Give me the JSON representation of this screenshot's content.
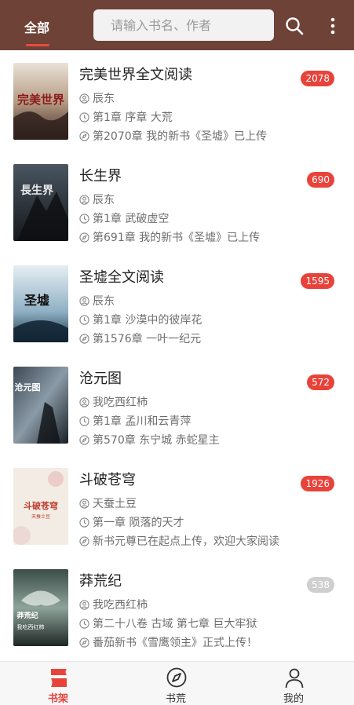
{
  "header": {
    "tab_label": "全部",
    "search_placeholder": "请输入书名、作者"
  },
  "books": [
    {
      "title": "完美世界全文阅读",
      "author": "辰东",
      "first_chapter": "第1章 序章 大荒",
      "latest_chapter": "第2070章 我的新书《圣墟》已上传",
      "badge": "2078",
      "badge_color": "#e8433b",
      "cover_text": "完美世界"
    },
    {
      "title": "长生界",
      "author": "辰东",
      "first_chapter": "第1章 武破虚空",
      "latest_chapter": "第691章 我的新书《圣墟》已上传",
      "badge": "690",
      "badge_color": "#e8433b",
      "cover_text": "長生界"
    },
    {
      "title": "圣墟全文阅读",
      "author": "辰东",
      "first_chapter": "第1章 沙漠中的彼岸花",
      "latest_chapter": "第1576章 一叶一纪元",
      "badge": "1595",
      "badge_color": "#e8433b",
      "cover_text": "圣墟"
    },
    {
      "title": "沧元图",
      "author": "我吃西红柿",
      "first_chapter": "第1章 孟川和云青萍",
      "latest_chapter": "第570章 东宁城 赤蛇星主",
      "badge": "572",
      "badge_color": "#e8433b",
      "cover_text": "沧元图"
    },
    {
      "title": "斗破苍穹",
      "author": "天蚕土豆",
      "first_chapter": "第一章 陨落的天才",
      "latest_chapter": "新书元尊已在起点上传，欢迎大家阅读",
      "badge": "1926",
      "badge_color": "#e8433b",
      "cover_text": "斗破苍穹",
      "cover_subtext": "天蚕土豆"
    },
    {
      "title": "莽荒纪",
      "author": "我吃西红柿",
      "first_chapter": "第二十八卷 古域 第七章 巨大牢狱",
      "latest_chapter": "番茄新书《雪鹰领主》正式上传！",
      "badge": "538",
      "badge_color": "#cfcfcf",
      "cover_text": "莽荒纪",
      "cover_subtext": "我吃西红柿"
    }
  ],
  "bottom_nav": [
    {
      "label": "书架",
      "icon": "bookshelf-icon",
      "active": true
    },
    {
      "label": "书荒",
      "icon": "compass-icon",
      "active": false
    },
    {
      "label": "我的",
      "icon": "person-icon",
      "active": false
    }
  ],
  "colors": {
    "header_bg": "#6e4236",
    "accent": "#e8433b",
    "badge_inactive": "#cfcfcf"
  }
}
